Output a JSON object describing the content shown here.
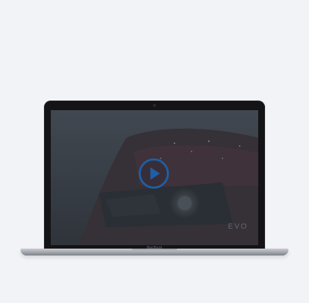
{
  "device": {
    "brand_label": "MacBook"
  },
  "video": {
    "play_icon": "play-icon",
    "accent_color": "#1e5fa8",
    "badge_text": "EVO"
  }
}
